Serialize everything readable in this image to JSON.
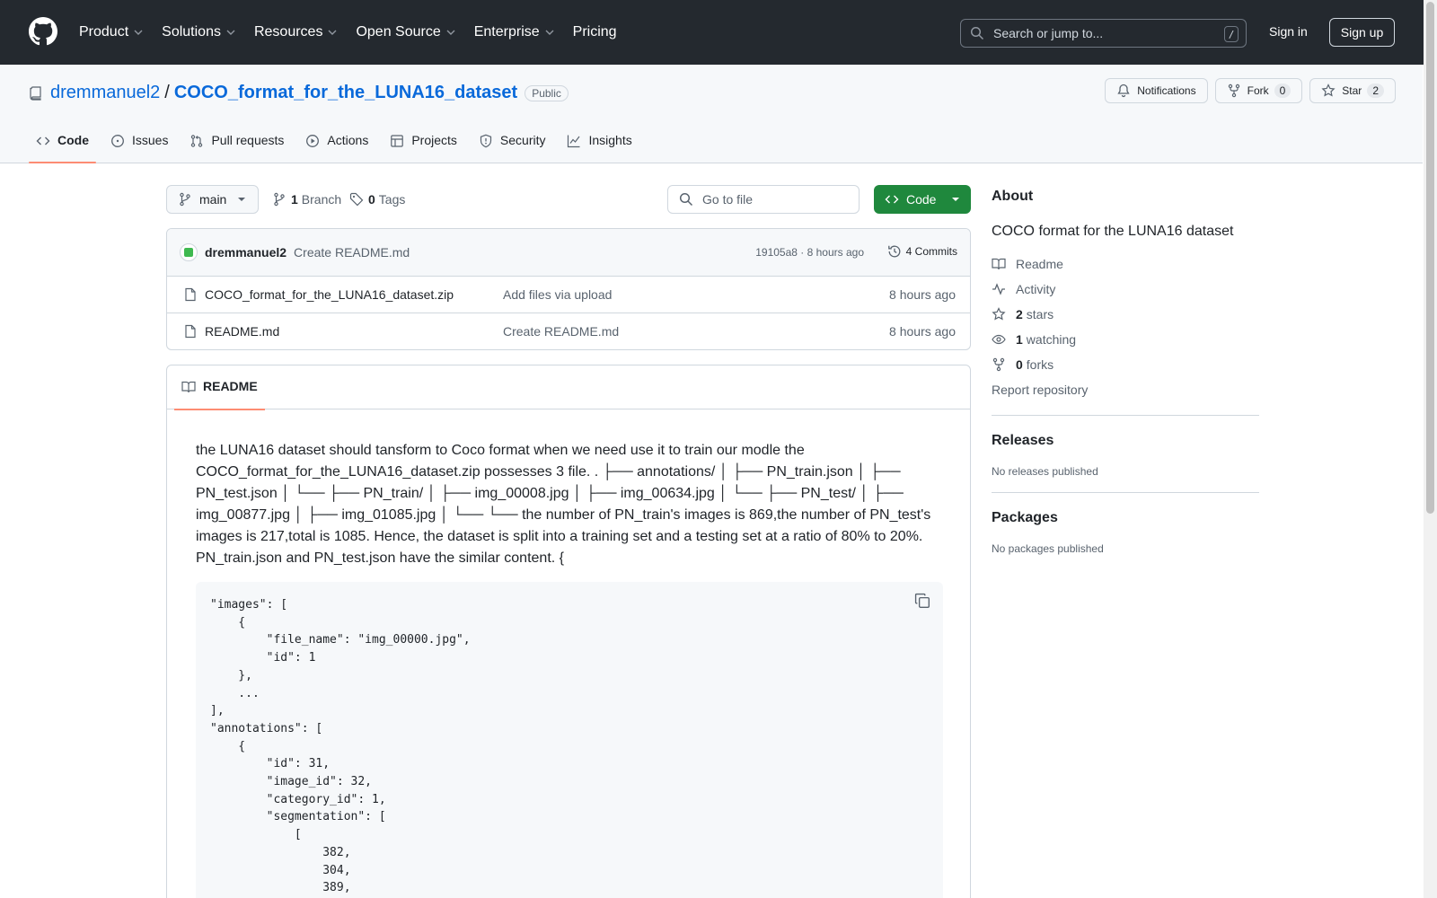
{
  "topnav": {
    "items": [
      "Product",
      "Solutions",
      "Resources",
      "Open Source",
      "Enterprise",
      "Pricing"
    ],
    "search_placeholder": "Search or jump to...",
    "search_key": "/",
    "signin": "Sign in",
    "signup": "Sign up"
  },
  "repo": {
    "owner": "dremmanuel2",
    "separator": "/",
    "name": "COCO_format_for_the_LUNA16_dataset",
    "visibility": "Public",
    "notifications": "Notifications",
    "fork_label": "Fork",
    "fork_count": "0",
    "star_label": "Star",
    "star_count": "2"
  },
  "tabs": [
    "Code",
    "Issues",
    "Pull requests",
    "Actions",
    "Projects",
    "Security",
    "Insights"
  ],
  "branch": {
    "name": "main",
    "branch_count": "1",
    "branch_label": "Branch",
    "tag_count": "0",
    "tag_label": "Tags",
    "goto_placeholder": "Go to file",
    "code_button": "Code"
  },
  "commit": {
    "author": "dremmanuel2",
    "message": "Create README.md",
    "meta": "19105a8 · 8 hours ago",
    "commits": "4 Commits"
  },
  "files": [
    {
      "name": "COCO_format_for_the_LUNA16_dataset.zip",
      "message": "Add files via upload",
      "time": "8 hours ago"
    },
    {
      "name": "README.md",
      "message": "Create README.md",
      "time": "8 hours ago"
    }
  ],
  "readme": {
    "tab": "README",
    "paragraph": "the LUNA16 dataset should tansform to Coco format when we need use it to train our modle the COCO_format_for_the_LUNA16_dataset.zip possesses 3 file. . ├── annotations/ │ ├── PN_train.json │ ├── PN_test.json │ └── ├── PN_train/ │ ├── img_00008.jpg │ ├── img_00634.jpg │ └── ├── PN_test/ │ ├── img_00877.jpg │ ├── img_01085.jpg │ └── └── the number of PN_train's images is 869,the number of PN_test's images is 217,total is 1085. Hence, the dataset is split into a training set and a testing set at a ratio of 80% to 20%. PN_train.json and PN_test.json have the similar content. {",
    "code": "\"images\": [\n    {\n        \"file_name\": \"img_00000.jpg\",\n        \"id\": 1\n    },\n    ...\n],\n\"annotations\": [\n    {\n        \"id\": 31,\n        \"image_id\": 32,\n        \"category_id\": 1,\n        \"segmentation\": [\n            [\n                382,\n                304,\n                389,"
  },
  "about": {
    "heading": "About",
    "description": "COCO format for the LUNA16 dataset",
    "readme": "Readme",
    "activity": "Activity",
    "stars_count": "2",
    "stars_label": "stars",
    "watching_count": "1",
    "watching_label": "watching",
    "forks_count": "0",
    "forks_label": "forks",
    "report": "Report repository"
  },
  "releases": {
    "heading": "Releases",
    "empty": "No releases published"
  },
  "packages": {
    "heading": "Packages",
    "empty": "No packages published"
  },
  "colors": {
    "header_bg": "#24292f",
    "link": "#0969da",
    "primary_button": "#1f883d",
    "tab_underline": "#fd8c73"
  }
}
